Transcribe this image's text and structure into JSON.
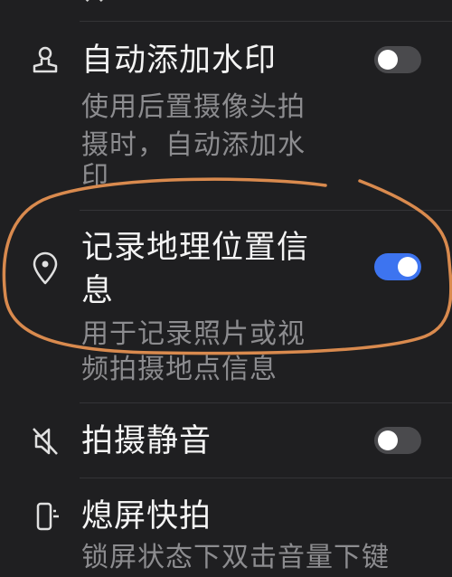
{
  "settings": {
    "items": [
      {
        "title": "自动添加水印",
        "description": "使用后置摄像头拍摄时，自动添加水印",
        "desc_line1": "使用后置摄像头拍",
        "desc_line2": "摄时，自动添加水",
        "desc_line3": "印",
        "icon": "stamp-icon",
        "toggle": "off"
      },
      {
        "title": "记录地理位置信息",
        "title_line1": "记录地理位置信",
        "title_line2": "息",
        "description": "用于记录照片或视频拍摄地点信息",
        "desc_line1": "用于记录照片或视",
        "desc_line2": "频拍摄地点信息",
        "icon": "location-pin-icon",
        "toggle": "on"
      },
      {
        "title": "拍摄静音",
        "icon": "mute-icon",
        "toggle": "off"
      },
      {
        "title": "熄屏快拍",
        "description": "锁屏状态下双击音量下键",
        "icon": "screen-off-snapshot-icon"
      }
    ]
  },
  "colors": {
    "background": "#1f1f21",
    "toggle_on": "#3d74f0",
    "toggle_off": "#4a4a4d",
    "annotation": "#d98a4e"
  }
}
